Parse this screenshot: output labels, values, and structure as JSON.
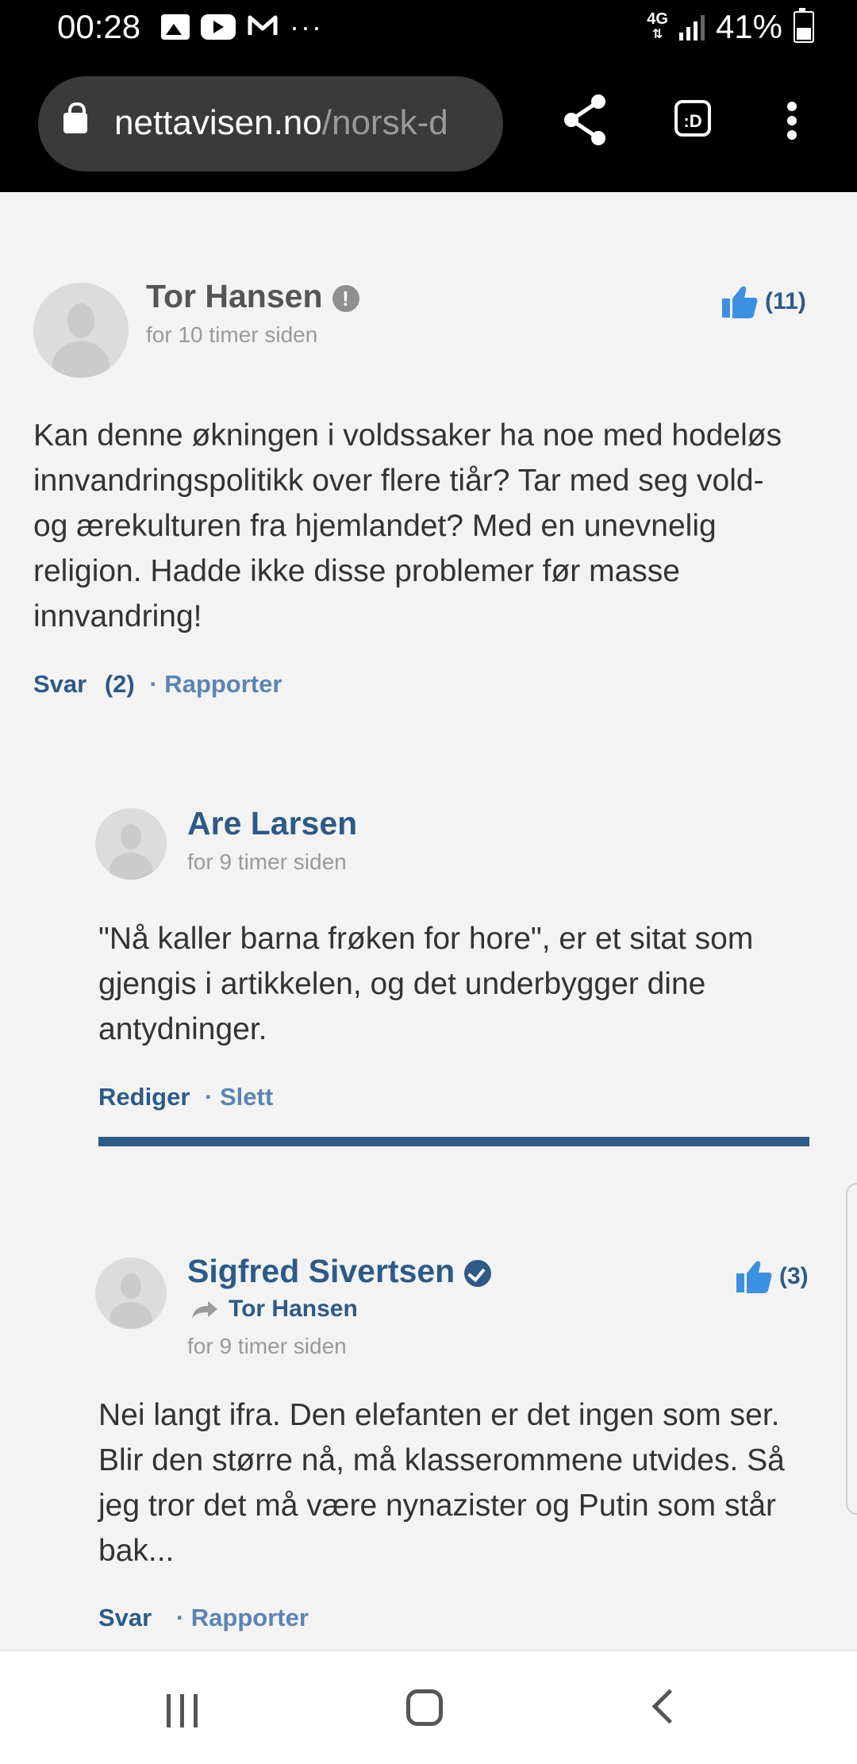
{
  "status_bar": {
    "time": "00:28",
    "icons": [
      "image-icon",
      "youtube-icon",
      "gmail-icon",
      "more-dots-icon"
    ],
    "network": "4G",
    "battery": "41%",
    "battery_level": 0.41
  },
  "browser": {
    "url_domain": "nettavisen.no",
    "url_path": "/norsk-d",
    "dex_label": ":D"
  },
  "comments": [
    {
      "author": "Tor Hansen",
      "time": "for 10 timer siden",
      "likes": "(11)",
      "text": "Kan denne økningen i voldssaker ha noe med hodeløs innvandringspolitikk over flere tiår? Tar med seg vold- og ærekulturen fra hjemlandet? Med en unevnelig religion. Hadde ikke disse problemer før masse innvandring!",
      "reply_label": "Svar",
      "reply_count": "(2)",
      "report_label": "· Rapporter",
      "badge": "!"
    },
    {
      "author": "Are Larsen",
      "time": "for 9 timer siden",
      "text": "\"Nå kaller barna frøken for hore\", er et sitat som gjengis i artikkelen, og det underbygger dine antydninger.",
      "edit_label": "Rediger",
      "delete_label": "· Slett"
    },
    {
      "author": "Sigfred Sivertsen",
      "reply_to": "Tor Hansen",
      "time": "for 9 timer siden",
      "likes": "(3)",
      "text": "Nei langt ifra. Den elefanten er det ingen som ser. Blir den større nå, må klasserommene utvides. Så jeg tror det må være nynazister og Putin som står bak...",
      "reply_label": "Svar",
      "report_label": "· Rapporter"
    }
  ],
  "colors": {
    "accent": "#2d5a87",
    "like_blue": "#3d8fe0",
    "link_secondary": "#5b84b1",
    "background": "#f3f3f3"
  }
}
